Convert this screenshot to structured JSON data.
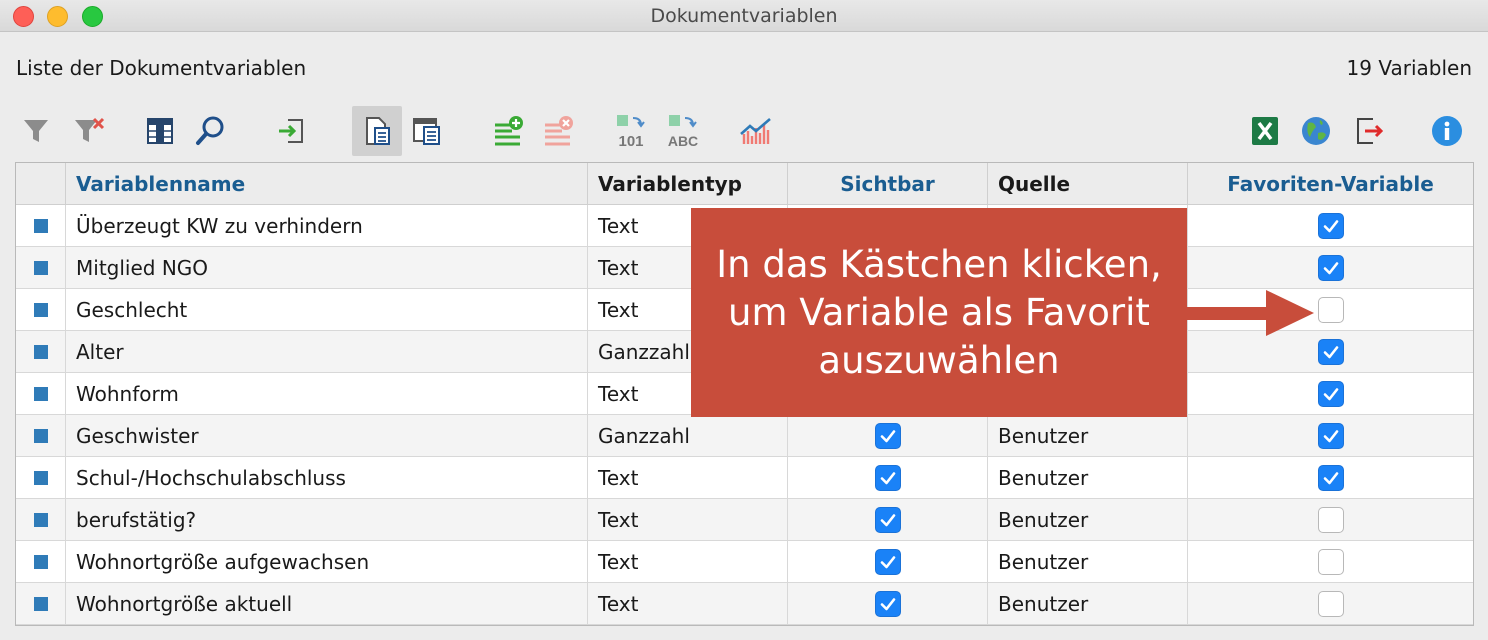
{
  "window": {
    "title": "Dokumentvariablen"
  },
  "header": {
    "list_title": "Liste der Dokumentvariablen",
    "count": "19 Variablen"
  },
  "toolbar": {
    "icons": [
      "filter-icon",
      "clear-filter-icon",
      "columns-icon",
      "search-icon",
      "import-icon",
      "list-view-icon",
      "detail-view-icon",
      "add-variable-icon",
      "delete-variable-icon",
      "convert-to-number-icon",
      "convert-to-text-icon",
      "statistics-icon",
      "excel-export-icon",
      "web-export-icon",
      "export-icon",
      "info-icon"
    ],
    "convert_number_label": "101",
    "convert_text_label": "ABC"
  },
  "table": {
    "columns": {
      "name": "Variablenname",
      "type": "Variablentyp",
      "visible": "Sichtbar",
      "source": "Quelle",
      "favorite": "Favoriten-Variable"
    },
    "rows": [
      {
        "name": "Überzeugt KW zu verhindern",
        "type": "Text",
        "visible": true,
        "source": "",
        "favorite": true
      },
      {
        "name": "Mitglied NGO",
        "type": "Text",
        "visible": true,
        "source": "",
        "favorite": true
      },
      {
        "name": "Geschlecht",
        "type": "Text",
        "visible": true,
        "source": "",
        "favorite": false
      },
      {
        "name": "Alter",
        "type": "Ganzzahl",
        "visible": true,
        "source": "",
        "favorite": true
      },
      {
        "name": "Wohnform",
        "type": "Text",
        "visible": true,
        "source": "",
        "favorite": true
      },
      {
        "name": "Geschwister",
        "type": "Ganzzahl",
        "visible": true,
        "source": "Benutzer",
        "favorite": true
      },
      {
        "name": "Schul-/Hochschulabschluss",
        "type": "Text",
        "visible": true,
        "source": "Benutzer",
        "favorite": true
      },
      {
        "name": "berufstätig?",
        "type": "Text",
        "visible": true,
        "source": "Benutzer",
        "favorite": false
      },
      {
        "name": "Wohnortgröße aufgewachsen",
        "type": "Text",
        "visible": true,
        "source": "Benutzer",
        "favorite": false
      },
      {
        "name": "Wohnortgröße aktuell",
        "type": "Text",
        "visible": true,
        "source": "Benutzer",
        "favorite": false
      }
    ]
  },
  "callout": {
    "line1": "In das Kästchen klicken,",
    "line2": "um Variable als Favorit",
    "line3": "auszuwählen"
  },
  "colors": {
    "accent": "#1a82f7",
    "callout": "#c84d3b",
    "header_blue": "#1a5d91",
    "marker": "#2f7bb8"
  }
}
